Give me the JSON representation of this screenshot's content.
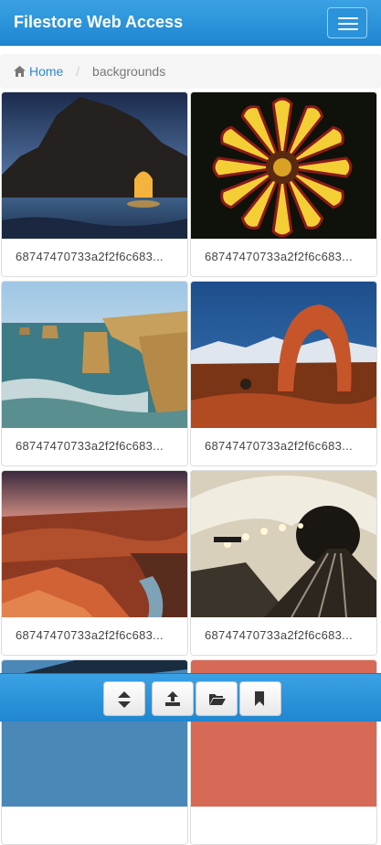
{
  "app": {
    "title": "Filestore Web Access"
  },
  "breadcrumb": {
    "home_label": "Home",
    "current": "backgrounds",
    "separator": "/"
  },
  "files": [
    {
      "name": "68747470733a2f2f6c683..."
    },
    {
      "name": "68747470733a2f2f6c683..."
    },
    {
      "name": "68747470733a2f2f6c683..."
    },
    {
      "name": "68747470733a2f2f6c683..."
    },
    {
      "name": "68747470733a2f2f6c683..."
    },
    {
      "name": "68747470733a2f2f6c683..."
    }
  ],
  "toolbar": {
    "icons": [
      "sort-icon",
      "upload-icon",
      "folder-open-icon",
      "bookmark-icon"
    ]
  },
  "colors": {
    "primary": "#2a8bd2",
    "navbar_top": "#3aa2e4",
    "navbar_bottom": "#1f86d0"
  }
}
